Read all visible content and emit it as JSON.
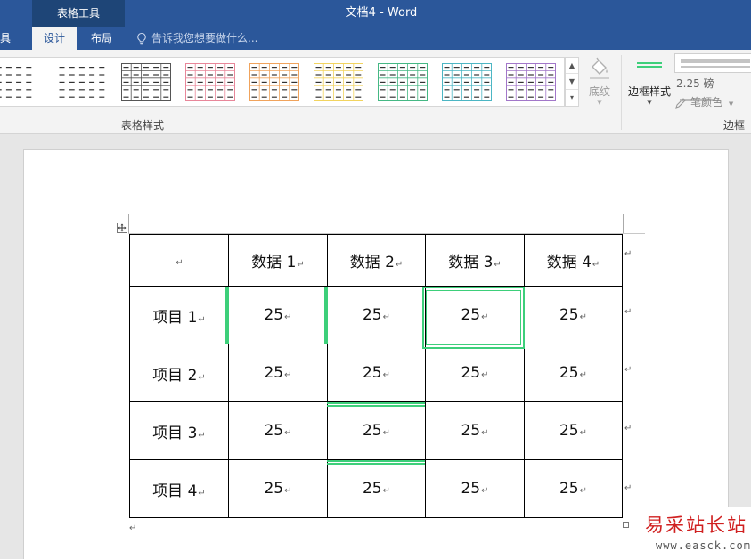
{
  "window": {
    "context_group": "表格工具",
    "title": "文档4 - Word"
  },
  "tabs": {
    "partial_tab": "工具",
    "design": "设计",
    "layout": "布局",
    "tell_me": "告诉我您想要做什么..."
  },
  "ribbon": {
    "group_table_styles": "表格样式",
    "shading_label": "底纹",
    "border_styles_label": "边框样式",
    "line_weight": "2.25 磅",
    "pen_color": "笔颜色",
    "group_borders": "边框",
    "style_accent_colors": [
      "#444444",
      "#444444",
      "#555555",
      "#e8879a",
      "#f0a35c",
      "#f2d45f",
      "#45b884",
      "#4cb6c4",
      "#a277c9"
    ],
    "border_color": "#3dcf7a"
  },
  "table": {
    "header": [
      "",
      "数据 1",
      "数据 2",
      "数据 3",
      "数据 4"
    ],
    "rows": [
      [
        "项目 1",
        "25",
        "25",
        "25",
        "25"
      ],
      [
        "项目 2",
        "25",
        "25",
        "25",
        "25"
      ],
      [
        "项目 3",
        "25",
        "25",
        "25",
        "25"
      ],
      [
        "项目 4",
        "25",
        "25",
        "25",
        "25"
      ]
    ],
    "paragraph_mark": "↵"
  },
  "watermark": {
    "title": "易采站长站",
    "url": "www.easck.com"
  }
}
